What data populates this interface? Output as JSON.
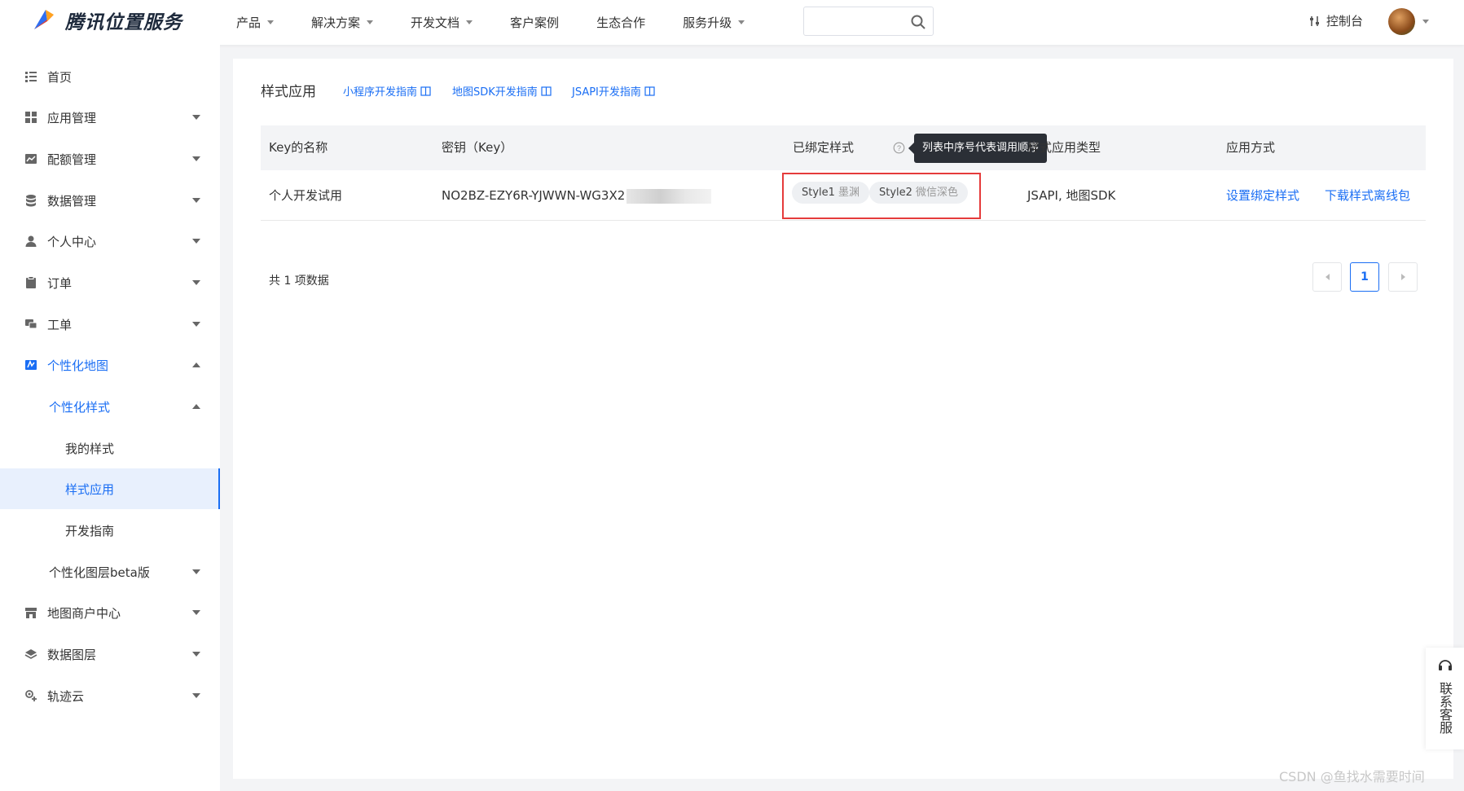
{
  "header": {
    "brand": "腾讯位置服务",
    "nav": [
      {
        "label": "产品",
        "has_caret": true
      },
      {
        "label": "解决方案",
        "has_caret": true
      },
      {
        "label": "开发文档",
        "has_caret": true
      },
      {
        "label": "客户案例",
        "has_caret": false
      },
      {
        "label": "生态合作",
        "has_caret": false
      },
      {
        "label": "服务升级",
        "has_caret": true
      }
    ],
    "search_placeholder": "",
    "console_label": "控制台"
  },
  "sidebar": {
    "items": [
      {
        "label": "首页",
        "icon": "list-icon"
      },
      {
        "label": "应用管理",
        "icon": "grid-icon"
      },
      {
        "label": "配额管理",
        "icon": "chart-icon"
      },
      {
        "label": "数据管理",
        "icon": "database-icon"
      },
      {
        "label": "个人中心",
        "icon": "user-icon"
      },
      {
        "label": "订单",
        "icon": "clipboard-icon"
      },
      {
        "label": "工单",
        "icon": "chat-icon"
      },
      {
        "label": "个性化地图",
        "icon": "map-style-icon"
      },
      {
        "label": "个性化样式",
        "icon": ""
      },
      {
        "label": "我的样式",
        "icon": ""
      },
      {
        "label": "样式应用",
        "icon": ""
      },
      {
        "label": "开发指南",
        "icon": ""
      },
      {
        "label": "个性化图层beta版",
        "icon": ""
      },
      {
        "label": "地图商户中心",
        "icon": "store-icon"
      },
      {
        "label": "数据图层",
        "icon": "layers-icon"
      },
      {
        "label": "轨迹云",
        "icon": "track-icon"
      }
    ]
  },
  "main": {
    "title": "样式应用",
    "guides": [
      "小程序开发指南",
      "地图SDK开发指南",
      "JSAPI开发指南"
    ],
    "table": {
      "headers": {
        "key_name": "Key的名称",
        "secret": "密钥（Key）",
        "bound_styles": "已绑定样式",
        "style_type": "样式应用类型",
        "apply_method": "应用方式"
      },
      "tooltip": "列表中序号代表调用顺序",
      "rows": [
        {
          "key_name": "个人开发试用",
          "secret": "NO2BZ-EZY6R-YJWWN-WG3X2",
          "styles": [
            {
              "name": "Style1",
              "sub": "墨渊"
            },
            {
              "name": "Style2",
              "sub": "微信深色"
            }
          ],
          "style_type": "JSAPI, 地图SDK",
          "action_set": "设置绑定样式",
          "action_download": "下载样式离线包"
        }
      ]
    },
    "total_text": "共 1 项数据",
    "current_page": "1"
  },
  "contact_label": "联系客服",
  "watermark": "CSDN @鱼找水需要时间"
}
